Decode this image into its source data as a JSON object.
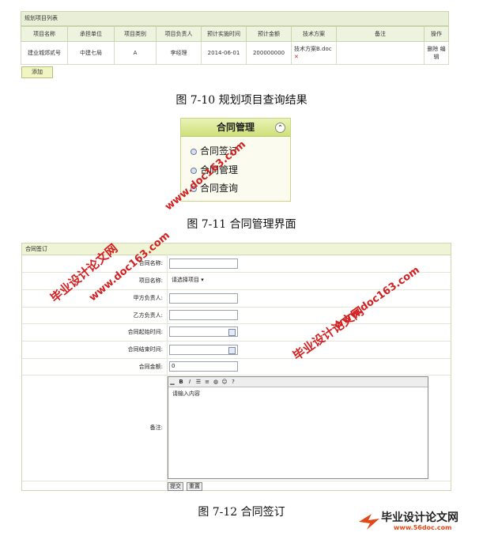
{
  "table1": {
    "caption": "规划项目列表",
    "headers": [
      "项目名称",
      "承担单位",
      "项目类别",
      "项目负责人",
      "预计实施时间",
      "预计金额",
      "技术方案",
      "备注",
      "操作"
    ],
    "row": {
      "name": "建业城郊贰号",
      "unit": "中建七局",
      "category": "A",
      "manager": "李经理",
      "time": "2014-06-01",
      "amount": "200000000",
      "file": "技术方案B.doc",
      "remark": "",
      "ops": "删除 编辑"
    },
    "add_label": "添加"
  },
  "fig10": "图 7-10 规划项目查询结果",
  "panel": {
    "title": "合同管理",
    "items": [
      "合同签订",
      "合同管理",
      "合同查询"
    ]
  },
  "fig11": "图 7-11 合同管理界面",
  "form": {
    "header": "合同签订",
    "labels": {
      "contract_name": "合同名称:",
      "project_name": "项目名称:",
      "party_a": "甲方负责人:",
      "party_b": "乙方负责人:",
      "start_time": "合同起始时间:",
      "end_time": "合同结束时间:",
      "amount": "合同金额:",
      "remark": "备注:"
    },
    "project_select": "请选择项目",
    "amount_value": "0",
    "editor_placeholder": "请输入内容",
    "submit": "提交",
    "reset": "重置"
  },
  "fig12": "图 7-12 合同签订",
  "watermarks": {
    "cn": "毕业设计论文网",
    "url": "www.doc163.com"
  },
  "logo": {
    "cn": "毕业设计论文网",
    "url": "www.56doc.com"
  }
}
